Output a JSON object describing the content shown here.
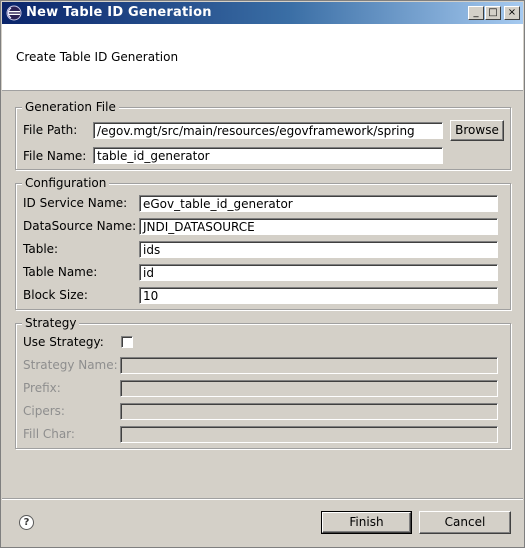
{
  "window": {
    "title": "New Table ID Generation",
    "controls": {
      "minimize": "_",
      "maximize": "□",
      "close": "×"
    }
  },
  "banner": {
    "text": "Create Table ID Generation"
  },
  "generation_file": {
    "legend": "Generation File",
    "file_path_label": "File Path:",
    "file_path_value": "/egov.mgt/src/main/resources/egovframework/spring",
    "browse_label": "Browse",
    "file_name_label": "File Name:",
    "file_name_value": "table_id_generator"
  },
  "configuration": {
    "legend": "Configuration",
    "fields": [
      {
        "label": "ID Service Name:",
        "value": "eGov_table_id_generator"
      },
      {
        "label": "DataSource Name:",
        "value": "JNDI_DATASOURCE"
      },
      {
        "label": "Table:",
        "value": "ids"
      },
      {
        "label": "Table Name:",
        "value": "id"
      },
      {
        "label": "Block Size:",
        "value": "10"
      }
    ]
  },
  "strategy": {
    "legend": "Strategy",
    "use_strategy_label": "Use Strategy:",
    "use_strategy_checked": false,
    "fields": [
      {
        "label": "Strategy Name:",
        "value": ""
      },
      {
        "label": "Prefix:",
        "value": ""
      },
      {
        "label": "Cipers:",
        "value": ""
      },
      {
        "label": "Fill Char:",
        "value": ""
      }
    ]
  },
  "footer": {
    "help_icon": "help-icon",
    "help_glyph": "?",
    "finish_label": "Finish",
    "cancel_label": "Cancel"
  },
  "colors": {
    "title_start": "#0a246a",
    "title_end": "#a6caf0",
    "dialog_bg": "#d4d0c8"
  }
}
